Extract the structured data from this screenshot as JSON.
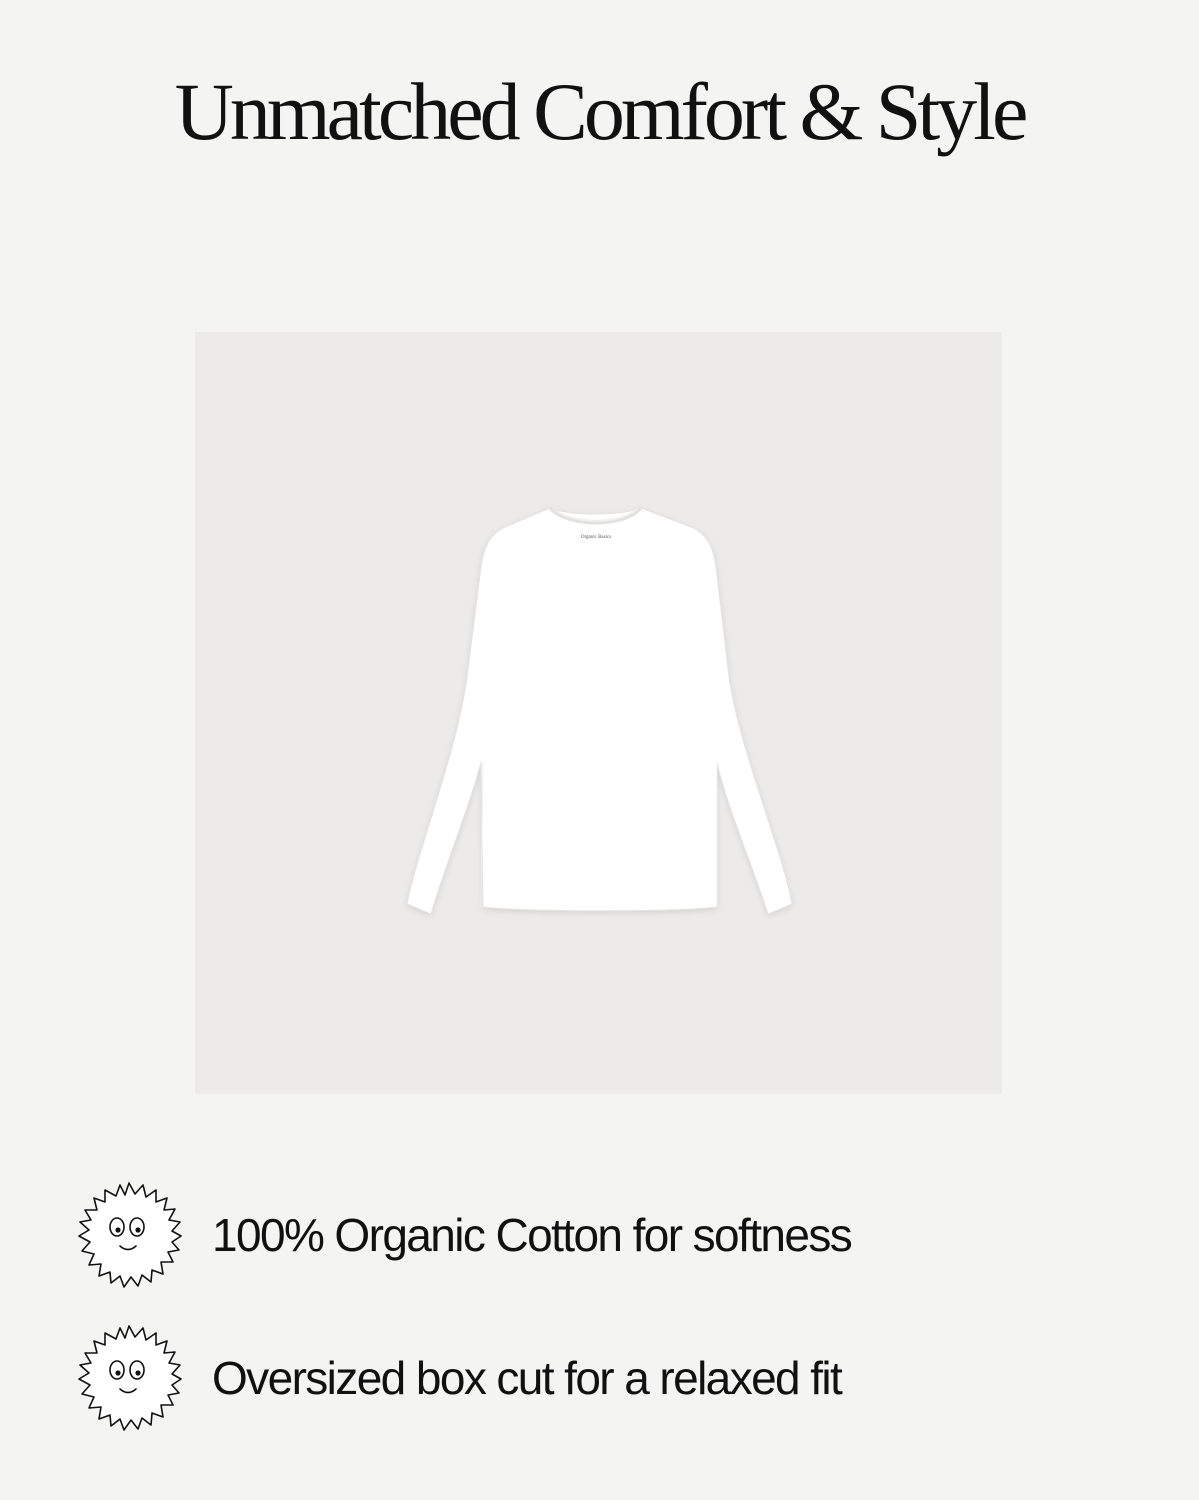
{
  "headline": "Unmatched Comfort & Style",
  "product": {
    "label_text": "Organic Basics",
    "panel_color": "#ecebe9",
    "shirt_color": "#ffffff"
  },
  "features": [
    {
      "text": "100% Organic Cotton for softness",
      "icon": "smiling-sun-icon"
    },
    {
      "text": "Oversized box cut for a relaxed fit",
      "icon": "smiling-sun-icon"
    }
  ],
  "colors": {
    "background": "#f4f4f3",
    "text": "#111111"
  }
}
